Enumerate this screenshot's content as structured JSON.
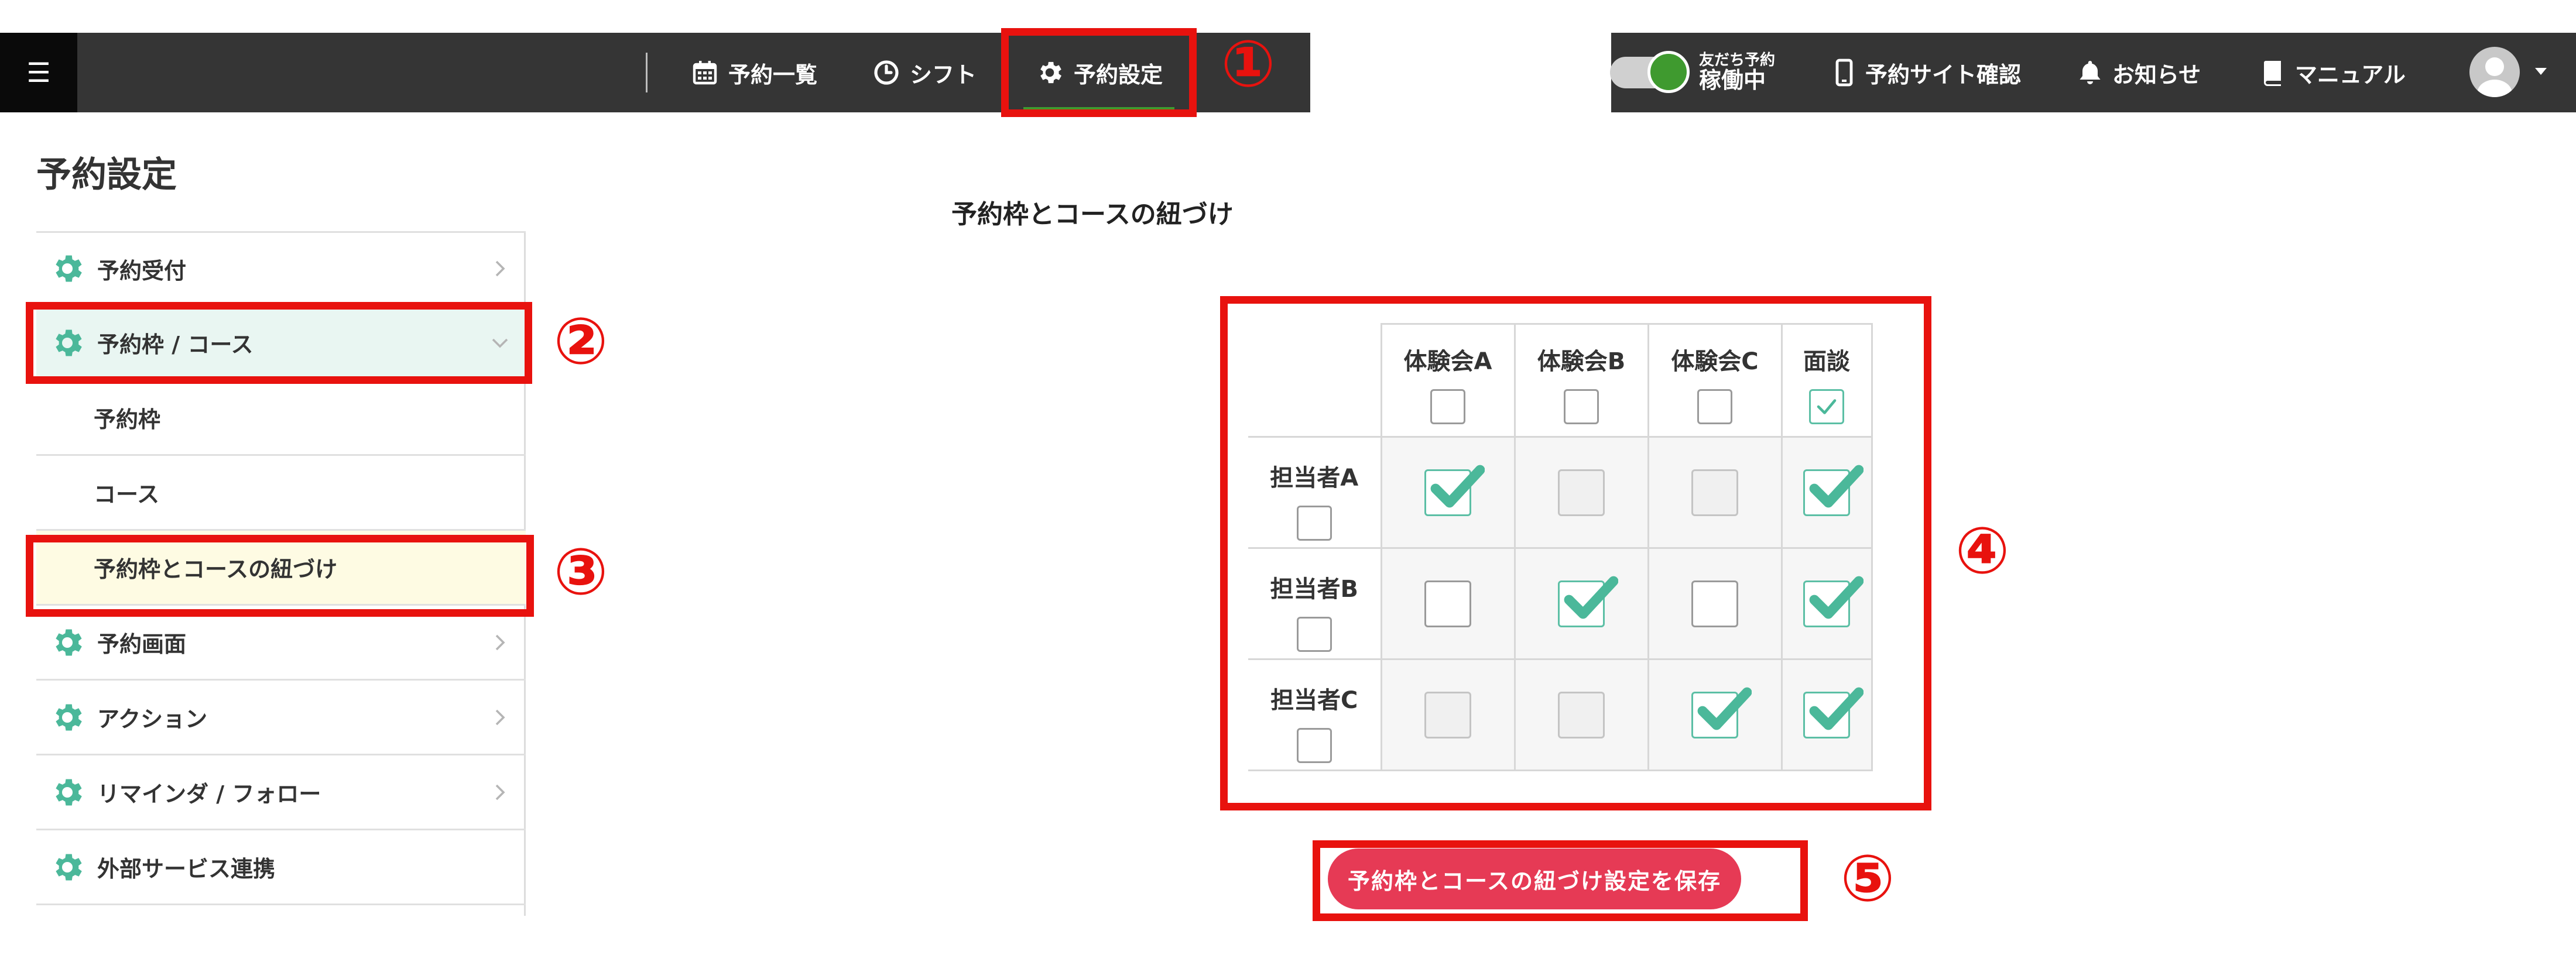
{
  "topbar": {
    "menu_icon": "☰",
    "nav": [
      {
        "label": "予約一覧",
        "icon": "calendar-icon"
      },
      {
        "label": "シフト",
        "icon": "clock-icon"
      },
      {
        "label": "予約設定",
        "icon": "gear-icon",
        "active": true
      }
    ],
    "toggle": {
      "small_label": "友だち予約",
      "state_label": "稼働中",
      "on": true
    },
    "right": [
      {
        "label": "予約サイト確認",
        "icon": "phone-icon"
      },
      {
        "label": "お知らせ",
        "icon": "bell-icon"
      },
      {
        "label": "マニュアル",
        "icon": "book-icon"
      }
    ]
  },
  "page": {
    "title": "予約設定",
    "section_title": "予約枠とコースの紐づけ"
  },
  "sidebar": {
    "items": [
      {
        "label": "予約受付"
      },
      {
        "label": "予約枠 / コース",
        "expanded": true
      },
      {
        "label": "予約枠"
      },
      {
        "label": "コース"
      },
      {
        "label": "予約枠とコースの紐づけ",
        "active": true
      },
      {
        "label": "予約画面"
      },
      {
        "label": "アクション"
      },
      {
        "label": "リマインダ / フォロー"
      },
      {
        "label": "外部サービス連携"
      }
    ]
  },
  "matrix": {
    "columns": [
      {
        "label": "体験会A",
        "checked": false
      },
      {
        "label": "体験会B",
        "checked": false
      },
      {
        "label": "体験会C",
        "checked": false
      },
      {
        "label": "面談",
        "checked": true
      }
    ],
    "rows": [
      {
        "label": "担当者A",
        "checked": false,
        "cells": [
          "checked",
          "grey",
          "grey",
          "checked"
        ]
      },
      {
        "label": "担当者B",
        "checked": false,
        "cells": [
          "empty",
          "checked",
          "empty",
          "checked"
        ]
      },
      {
        "label": "担当者C",
        "checked": false,
        "cells": [
          "grey",
          "grey",
          "checked",
          "checked"
        ]
      }
    ]
  },
  "save_button": {
    "label": "予約枠とコースの紐づけ設定を保存"
  },
  "annotations": [
    "①",
    "②",
    "③",
    "④",
    "⑤"
  ],
  "colors": {
    "topbar": "#353535",
    "accent_green": "#3f9a2f",
    "teal": "#4bb89a",
    "annotation_red": "#e8120e",
    "save_button": "#e63a55",
    "sidebar_expanded_bg": "#e9f6f2",
    "sidebar_active_bg": "#fefbe3"
  }
}
